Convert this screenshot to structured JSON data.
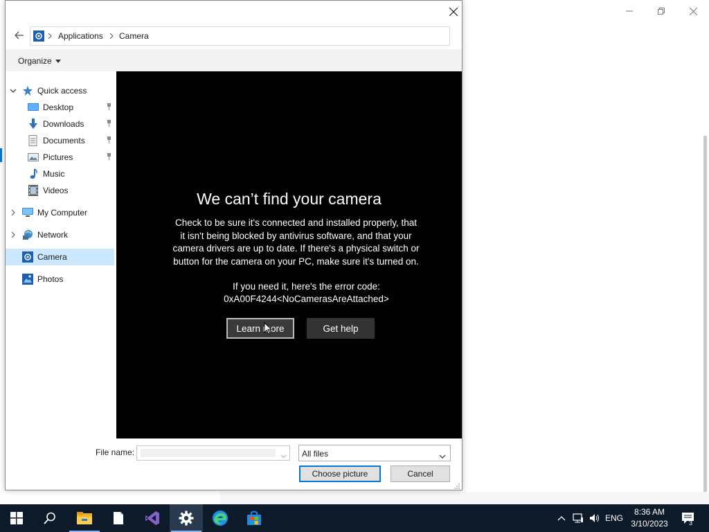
{
  "background_window": {
    "controls": [
      "minimize-icon",
      "restore-icon",
      "close-icon"
    ]
  },
  "dialog": {
    "address": {
      "root_icon": "camera-app-icon",
      "crumbs": [
        "Applications",
        "Camera"
      ]
    },
    "toolbar": {
      "organize_label": "Organize"
    },
    "nav": {
      "quick_access": "Quick access",
      "items": [
        {
          "label": "Desktop",
          "icon": "desktop-icon",
          "pinned": true
        },
        {
          "label": "Downloads",
          "icon": "downloads-icon",
          "pinned": true
        },
        {
          "label": "Documents",
          "icon": "documents-icon",
          "pinned": true
        },
        {
          "label": "Pictures",
          "icon": "pictures-icon",
          "pinned": true
        },
        {
          "label": "Music",
          "icon": "music-icon",
          "pinned": false
        },
        {
          "label": "Videos",
          "icon": "videos-icon",
          "pinned": false
        }
      ],
      "my_computer": "My Computer",
      "network": "Network",
      "camera": "Camera",
      "photos": "Photos"
    },
    "preview": {
      "title": "We can’t find your camera",
      "body": "Check to be sure it's connected and installed properly, that it isn't being blocked by antivirus software, and that your camera drivers are up to date. If there's a physical switch or button for the camera on your PC, make sure it's turned on.",
      "error_intro": "If you need it, here's the error code:",
      "error_code": "0xA00F4244<NoCamerasAreAttached>",
      "learn_more": "Learn more",
      "get_help": "Get help"
    },
    "footer": {
      "file_name_label": "File name:",
      "file_name_value": "",
      "file_type": "All files",
      "choose_label": "Choose picture",
      "cancel_label": "Cancel"
    }
  },
  "taskbar": {
    "apps": [
      "start-icon",
      "search-icon",
      "file-explorer-icon",
      "notepad-icon",
      "visual-studio-icon",
      "settings-icon",
      "edge-icon",
      "store-icon"
    ],
    "active_app": "settings-icon",
    "tray": {
      "language": "ENG",
      "time": "8:36 AM",
      "date": "3/10/2023",
      "notifications_count": "3"
    }
  },
  "colors": {
    "accent": "#0078d4",
    "taskbar": "#0c1a2a",
    "nav_selected": "#cce8ff",
    "preview_bg": "#000000"
  }
}
